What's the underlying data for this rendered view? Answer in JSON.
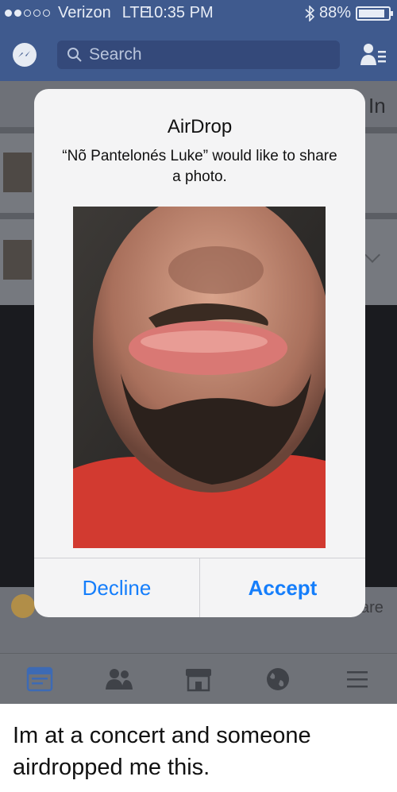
{
  "status_bar": {
    "carrier": "Verizon",
    "network": "LTE",
    "time": "10:35 PM",
    "battery_text": "88%",
    "battery_level": 0.88,
    "signal_bars_on": 2,
    "signal_bars_total": 5
  },
  "nav_bar": {
    "search_placeholder": "Search",
    "messenger_icon": "messenger-icon",
    "friend_requests_icon": "friend-requests-icon",
    "color": "#3f5a8e"
  },
  "feed": {
    "edge_text_top": "In",
    "edge_text_bottom": "are"
  },
  "airdrop_alert": {
    "title": "AirDrop",
    "message": "“Nõ Pantelonés Luke” would like to share a photo.",
    "decline_label": "Decline",
    "accept_label": "Accept",
    "button_color": "#157efb"
  },
  "tab_bar": {
    "tabs": [
      "news-feed-icon",
      "friends-icon",
      "marketplace-icon",
      "globe-icon",
      "menu-icon"
    ]
  },
  "caption": "Im at a concert and someone airdropped me this."
}
